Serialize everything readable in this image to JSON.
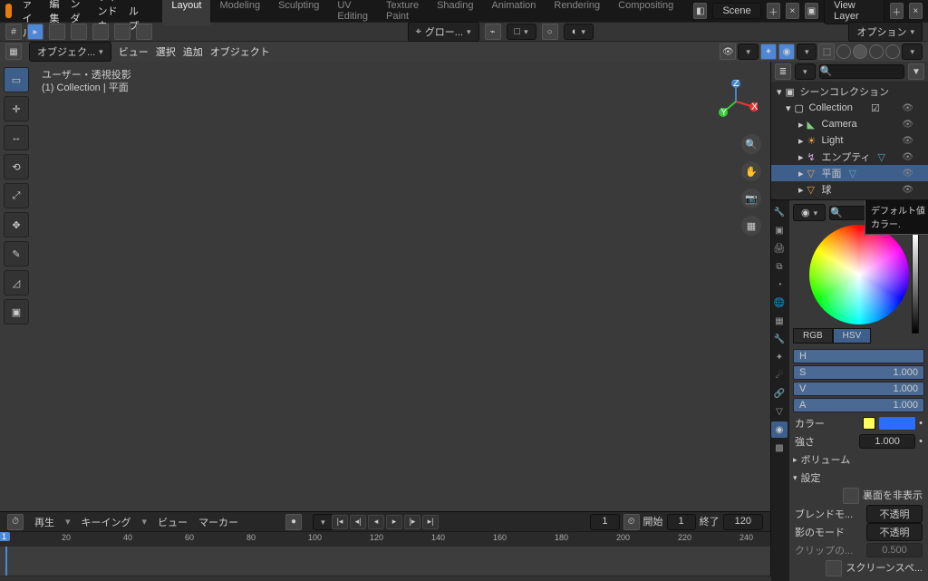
{
  "top_menu": {
    "items": [
      "ファイル",
      "編集",
      "レンダー",
      "ウィンドウ",
      "ヘルプ"
    ]
  },
  "workspaces": [
    "Layout",
    "Modeling",
    "Sculpting",
    "UV Editing",
    "Texture Paint",
    "Shading",
    "Animation",
    "Rendering",
    "Compositing"
  ],
  "active_workspace": 0,
  "scene_field": "Scene",
  "viewlayer_field": "View Layer",
  "hdr2": {
    "mode": "オブジェク...",
    "shading_label": "グロー...",
    "options_label": "オプション"
  },
  "hdr3": {
    "menus": [
      "ビュー",
      "選択",
      "追加",
      "オブジェクト"
    ]
  },
  "overlay": {
    "line1": "ユーザー・透視投影",
    "line2": "(1) Collection | 平面"
  },
  "toolbar_icons": [
    "select",
    "cursor",
    "move",
    "rotate",
    "scale",
    "transform",
    "annot",
    "measure",
    "add"
  ],
  "outliner": {
    "root": "シーンコレクション",
    "collection": "Collection",
    "items": [
      {
        "icon": "cam",
        "label": "Camera",
        "color": "#7fcf7f"
      },
      {
        "icon": "light",
        "label": "Light",
        "color": "#e8a04a"
      },
      {
        "icon": "empty",
        "label": "エンプティ",
        "color": "#d8a8e8"
      },
      {
        "icon": "mesh",
        "label": "平面",
        "color": "#e8a04a",
        "selected": true
      },
      {
        "icon": "mesh",
        "label": "球",
        "color": "#e8a04a"
      }
    ]
  },
  "color_tabs": [
    "RGB",
    "HSV"
  ],
  "tooltip": "デフォルト値\nカラー.",
  "sliders": [
    {
      "label": "H",
      "value": ""
    },
    {
      "label": "S",
      "value": "1.000"
    },
    {
      "label": "V",
      "value": "1.000"
    },
    {
      "label": "A",
      "value": "1.000"
    }
  ],
  "prop_rows": [
    {
      "label": "カラー",
      "swatch": "#ffff55",
      "link": true
    },
    {
      "label": "強さ",
      "value": "1.000"
    }
  ],
  "sections": [
    "ボリューム",
    "設定"
  ],
  "settings": {
    "backface": "裏面を非表示",
    "blend_label": "ブレンドモ...",
    "blend_value": "不透明",
    "shadow_label": "影のモード",
    "shadow_value": "不透明",
    "clip_label": "クリップの...",
    "clip_value": "0.500",
    "ss_label": "スクリーンスペ..."
  },
  "timeline": {
    "menus": [
      "再生",
      "キーイング",
      "ビュー",
      "マーカー"
    ],
    "current": "1",
    "start_label": "開始",
    "start": "1",
    "end_label": "終了",
    "end": "120",
    "ticks": [
      0,
      20,
      40,
      60,
      80,
      100,
      120,
      140,
      160,
      180,
      200,
      220,
      240
    ]
  }
}
